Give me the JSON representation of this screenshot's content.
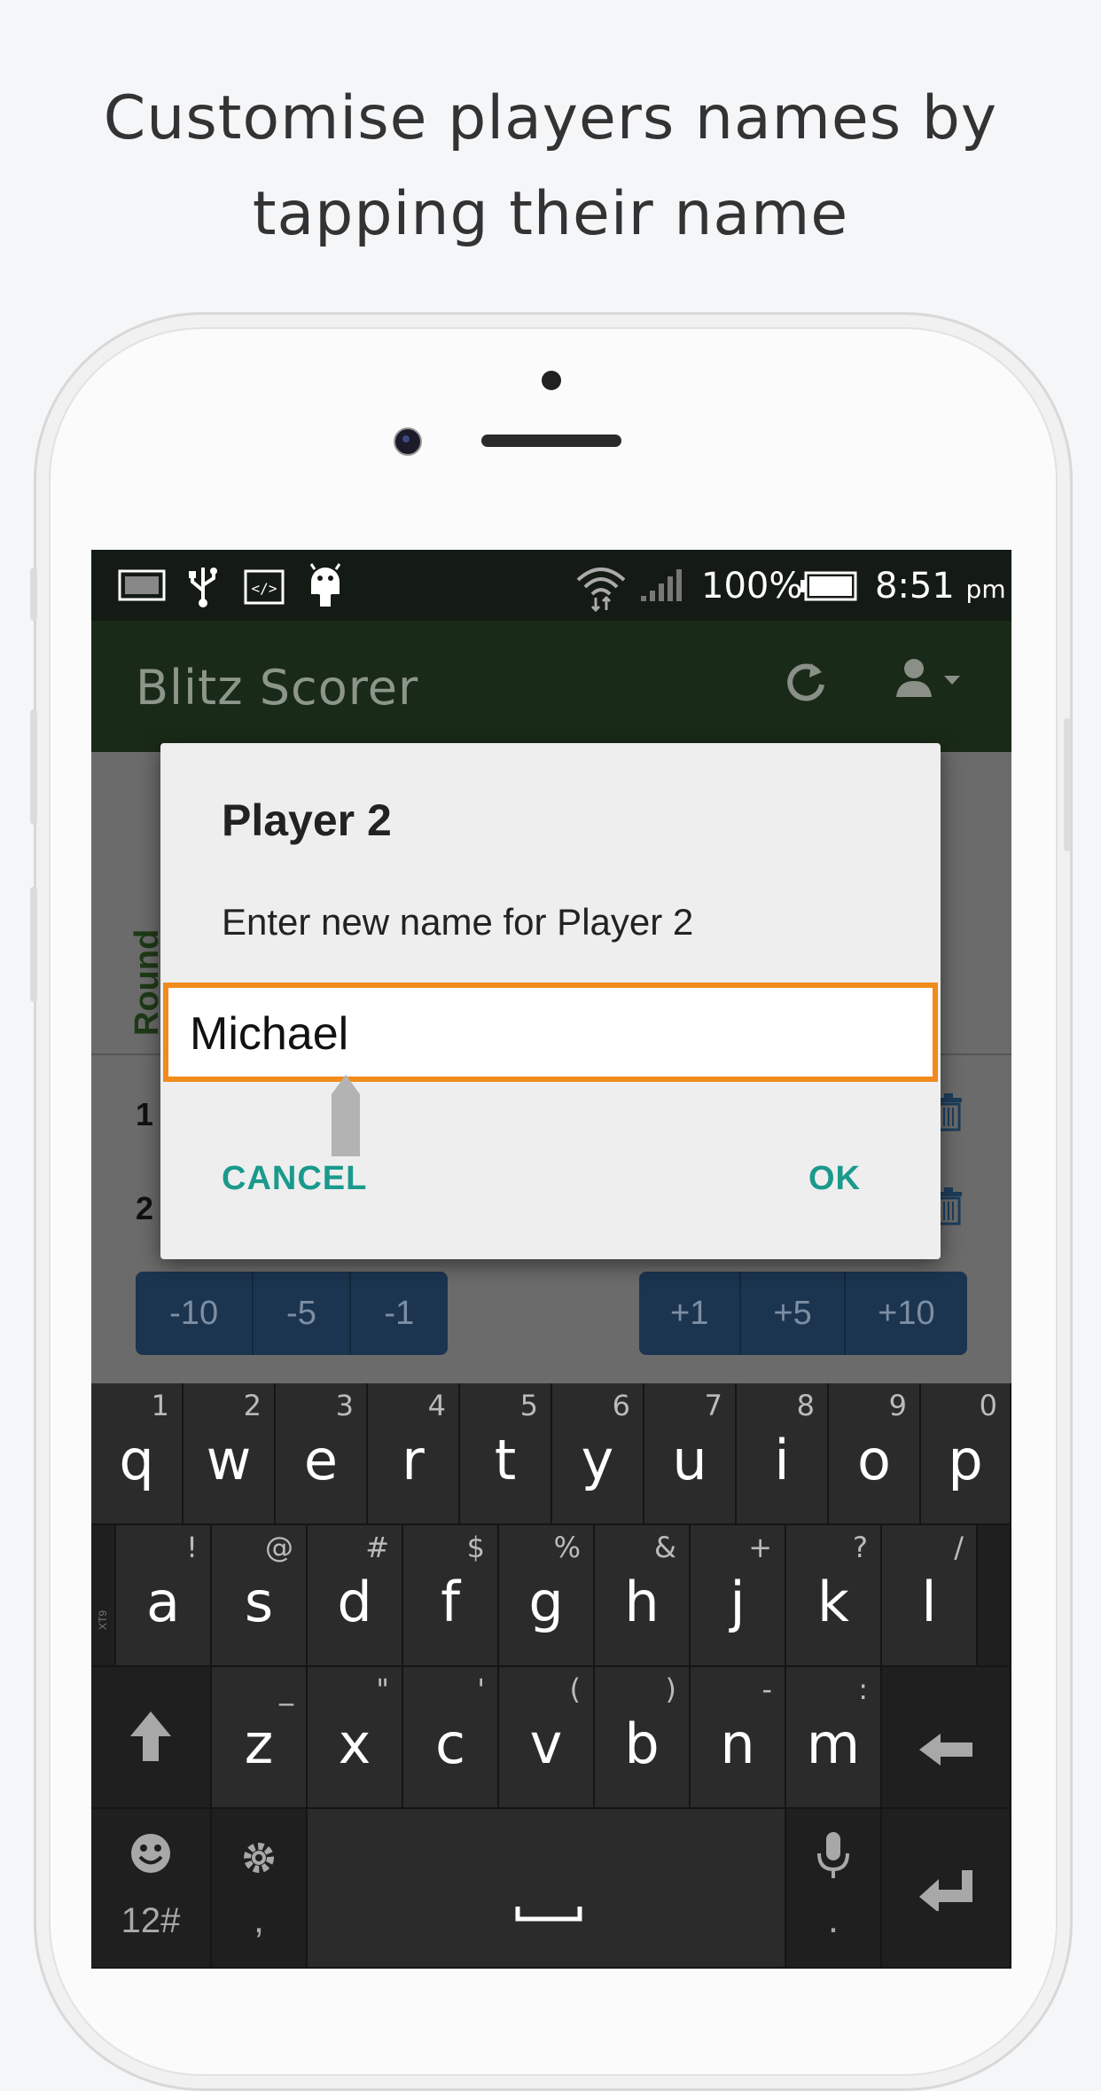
{
  "caption": {
    "line1": "Customise players names by",
    "line2": "tapping their name"
  },
  "status_bar": {
    "battery": "100%",
    "time": "8:51",
    "ampm": "pm",
    "left_icons": [
      "image-icon",
      "usb-icon",
      "code-icon",
      "android-icon"
    ],
    "right_icons": [
      "wifi-icon",
      "signal-icon",
      "battery-icon"
    ]
  },
  "app_bar": {
    "title": "Blitz Scorer",
    "icons": [
      "refresh-icon",
      "user-icon",
      "dropdown-icon"
    ]
  },
  "background_content": {
    "round_label": "Round",
    "rows": [
      "1",
      "2"
    ],
    "minus_buttons": [
      "-10",
      "-5",
      "-1"
    ],
    "plus_buttons": [
      "+1",
      "+5",
      "+10"
    ]
  },
  "dialog": {
    "title": "Player 2",
    "message": "Enter new name for Player 2",
    "input_value": "Michael",
    "cancel_label": "CANCEL",
    "ok_label": "OK"
  },
  "keyboard": {
    "row1": [
      {
        "key": "q",
        "hint": "1"
      },
      {
        "key": "w",
        "hint": "2"
      },
      {
        "key": "e",
        "hint": "3"
      },
      {
        "key": "r",
        "hint": "4"
      },
      {
        "key": "t",
        "hint": "5"
      },
      {
        "key": "y",
        "hint": "6"
      },
      {
        "key": "u",
        "hint": "7"
      },
      {
        "key": "i",
        "hint": "8"
      },
      {
        "key": "o",
        "hint": "9"
      },
      {
        "key": "p",
        "hint": "0"
      }
    ],
    "row2": [
      {
        "key": "a",
        "hint": "!"
      },
      {
        "key": "s",
        "hint": "@"
      },
      {
        "key": "d",
        "hint": "#"
      },
      {
        "key": "f",
        "hint": "$"
      },
      {
        "key": "g",
        "hint": "%"
      },
      {
        "key": "h",
        "hint": "&"
      },
      {
        "key": "j",
        "hint": "+"
      },
      {
        "key": "k",
        "hint": "?"
      },
      {
        "key": "l",
        "hint": "/"
      }
    ],
    "row2_side_label": "XT9",
    "row3": [
      {
        "key": "z",
        "hint": "_"
      },
      {
        "key": "x",
        "hint": "\""
      },
      {
        "key": "c",
        "hint": "'"
      },
      {
        "key": "v",
        "hint": "("
      },
      {
        "key": "b",
        "hint": ")"
      },
      {
        "key": "n",
        "hint": "-"
      },
      {
        "key": "m",
        "hint": ":"
      }
    ],
    "symbols_label": "12#",
    "comma_label": ",",
    "period_label": "."
  }
}
